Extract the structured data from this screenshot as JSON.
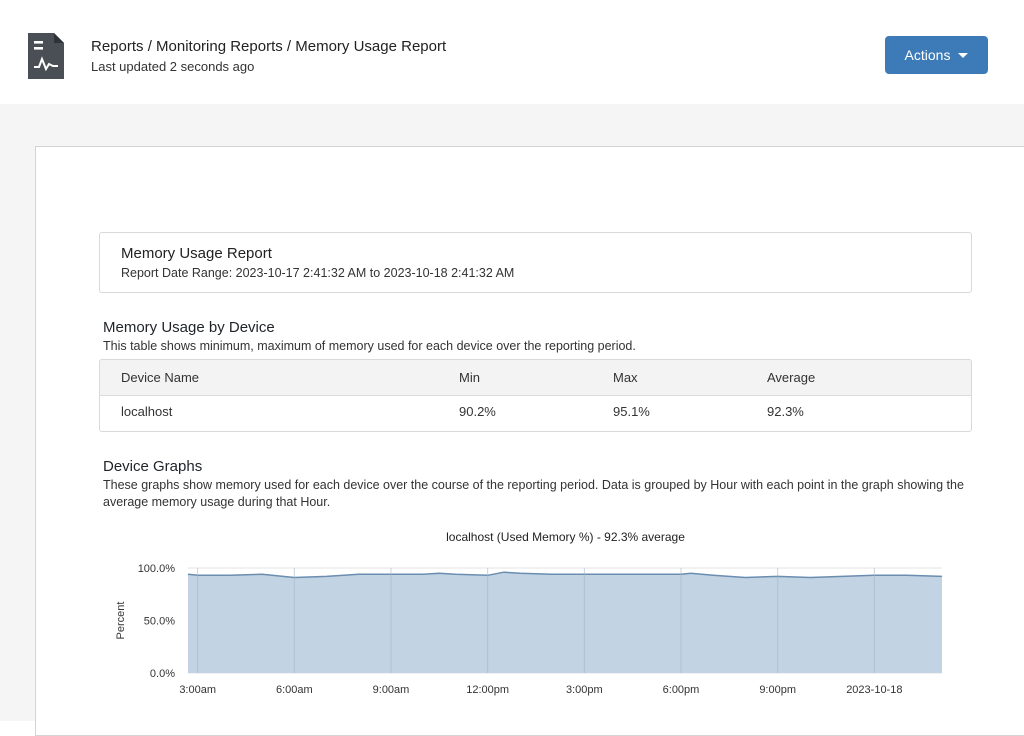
{
  "header": {
    "breadcrumb": "Reports / Monitoring Reports / Memory Usage Report",
    "last_updated": "Last updated 2 seconds ago",
    "actions_label": "Actions"
  },
  "summary": {
    "title": "Memory Usage Report",
    "date_range": "Report Date Range: 2023-10-17 2:41:32 AM to 2023-10-18 2:41:32 AM"
  },
  "usage_section": {
    "title": "Memory Usage by Device",
    "description": "This table shows minimum, maximum of memory used for each device over the reporting period.",
    "columns": [
      "Device Name",
      "Min",
      "Max",
      "Average"
    ],
    "rows": [
      [
        "localhost",
        "90.2%",
        "95.1%",
        "92.3%"
      ]
    ]
  },
  "graphs_section": {
    "title": "Device Graphs",
    "description": "These graphs show memory used for each device over the course of the reporting period. Data is grouped by Hour with each point in the graph showing the average memory usage during that Hour."
  },
  "chart_data": {
    "type": "area",
    "title": "localhost (Used Memory %) - 92.3% average",
    "ylabel": "Percent",
    "xlabel": "",
    "ylim": [
      0,
      100
    ],
    "yticks": [
      "100.0%",
      "50.0%",
      "0.0%"
    ],
    "xticks": [
      "3:00am",
      "6:00am",
      "9:00am",
      "12:00pm",
      "3:00pm",
      "6:00pm",
      "9:00pm",
      "2023-10-18"
    ],
    "grid": true,
    "color": "#c2d3e3",
    "line_color": "#6b8db0",
    "x_hours": [
      2.7,
      3,
      4,
      5,
      6,
      7,
      8,
      9,
      10,
      10.5,
      11,
      12,
      12.5,
      13,
      14,
      15,
      16,
      17,
      18,
      18.3,
      19,
      20,
      21,
      22,
      23,
      24,
      25,
      26.1
    ],
    "values": [
      94,
      93,
      93,
      94,
      91,
      92,
      94,
      94,
      94,
      95,
      94,
      93,
      96,
      95,
      94,
      94,
      94,
      94,
      94,
      95,
      93,
      91,
      92,
      91,
      92,
      93,
      93,
      92
    ]
  }
}
